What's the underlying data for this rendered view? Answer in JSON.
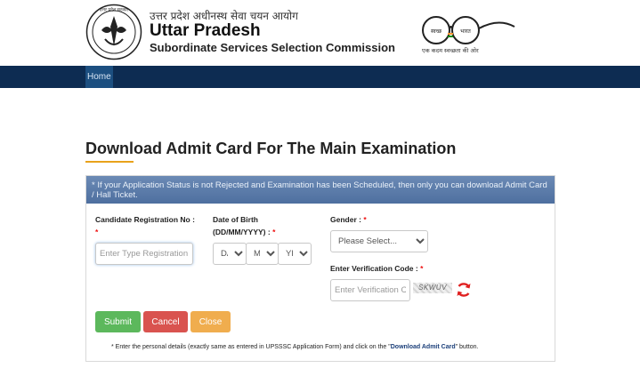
{
  "header": {
    "hindi_title": "उत्तर प्रदेश अधीनस्थ सेवा चयन आयोग",
    "title": "Uttar Pradesh",
    "subtitle": "Subordinate Services Selection Commission",
    "seal_text": "उत्तर प्रदेश सरकार",
    "swachh_left": "स्वच्छ",
    "swachh_right": "भारत",
    "swachh_tagline": "एक कदम स्वच्छता की ओर"
  },
  "nav": {
    "home": "Home"
  },
  "page": {
    "title": "Download Admit Card For The Main Examination"
  },
  "notice": "* If your Application Status is not Rejected and Examination has been Scheduled, then only you can download Admit Card / Hall Ticket.",
  "form": {
    "registration": {
      "label": "Candidate Registration No :",
      "required": "*",
      "placeholder": "Enter Type Registration No"
    },
    "dob": {
      "label": "Date of Birth (DD/MM/YYYY) :",
      "required": "*",
      "day": "DAY",
      "month": "MONTH",
      "year": "YEAR"
    },
    "gender": {
      "label": "Gender :",
      "required": "*",
      "selected": "Please Select..."
    },
    "captcha": {
      "label": "Enter Verification Code :",
      "required": "*",
      "placeholder": "Enter Verification Code",
      "code": "SKWUV"
    }
  },
  "buttons": {
    "submit": "Submit",
    "cancel": "Cancel",
    "close": "Close"
  },
  "footer_note": {
    "prefix": "* Enter the personal details (exactly same as entered in UPSSSC Application Form) and click on the \"",
    "link": "Download Admit Card",
    "suffix": "\" button."
  },
  "colors": {
    "nav": "#0d2c52",
    "accent": "#e8a21b",
    "submit": "#5cb85c",
    "cancel": "#d9534f",
    "close": "#f0ad4e"
  }
}
